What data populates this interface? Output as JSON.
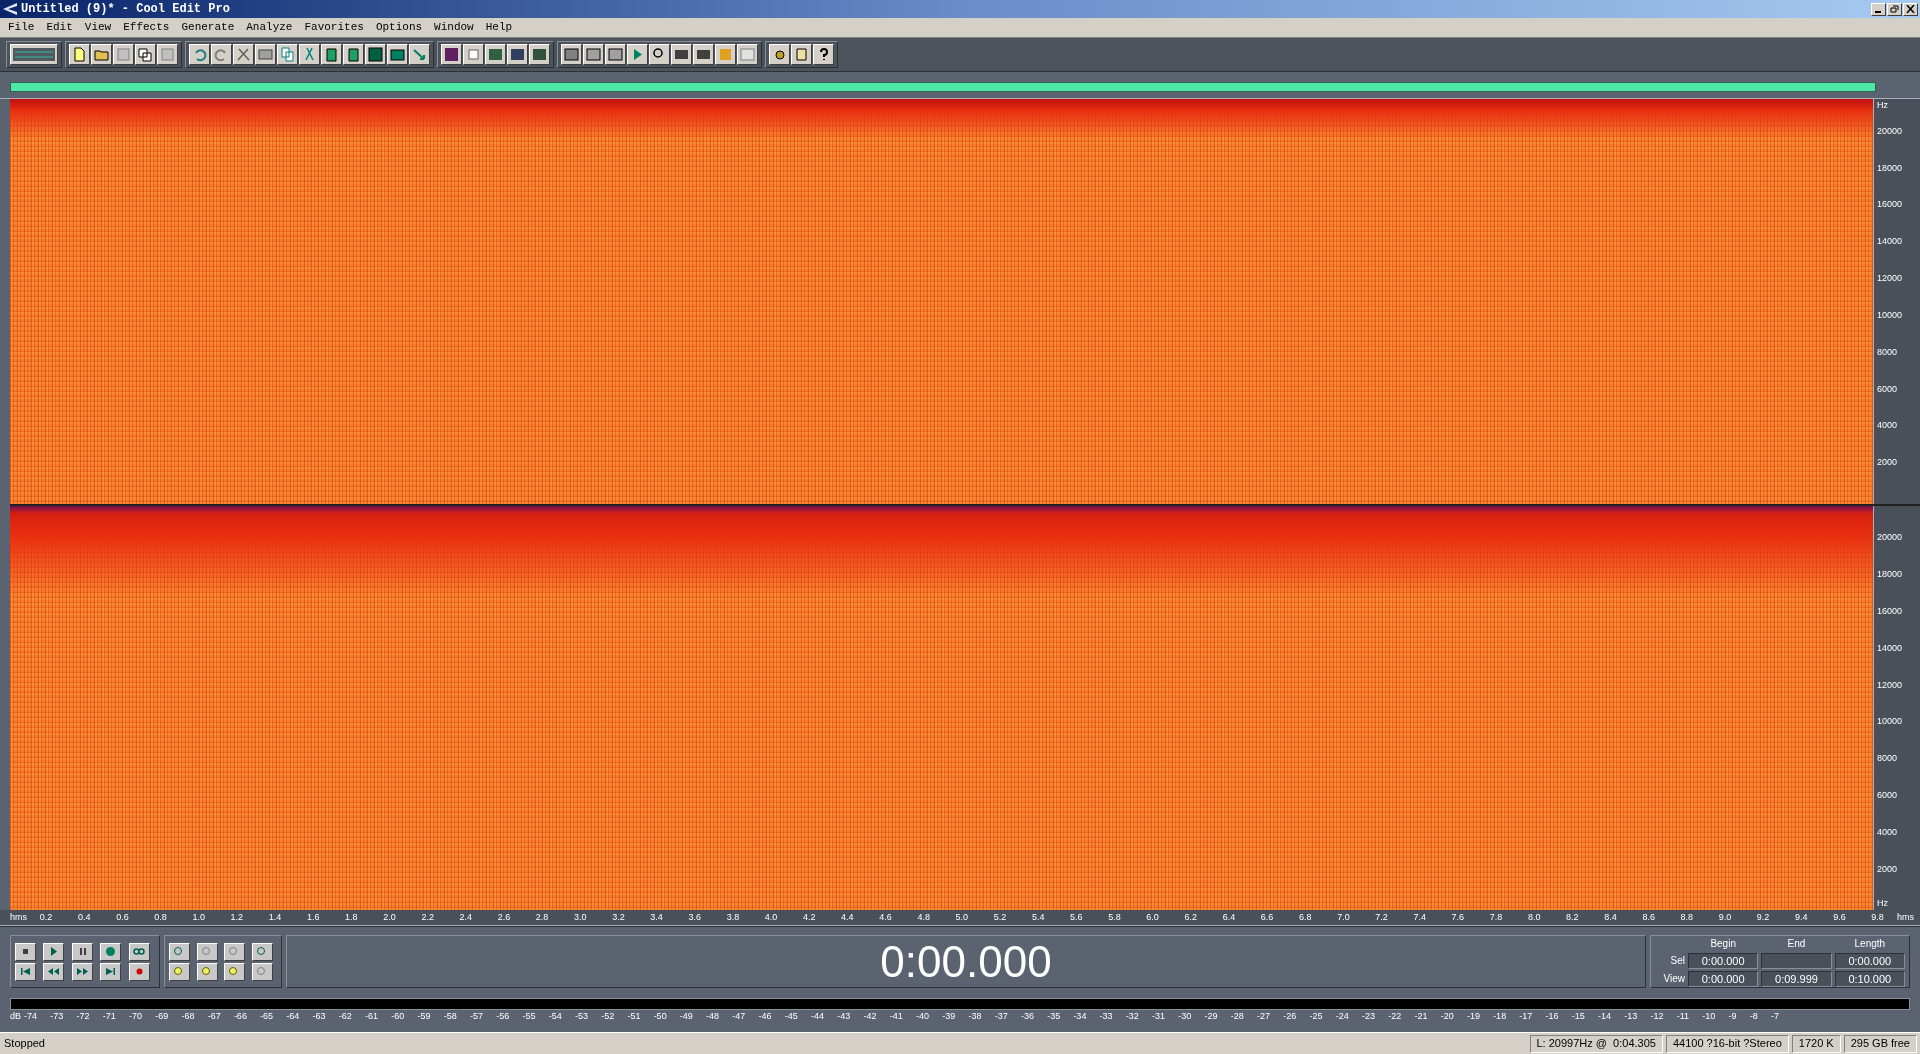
{
  "window": {
    "title": "Untitled (9)* - Cool Edit Pro"
  },
  "menu": [
    "File",
    "Edit",
    "View",
    "Effects",
    "Generate",
    "Analyze",
    "Favorites",
    "Options",
    "Window",
    "Help"
  ],
  "channels": [
    {
      "unit_top": "Hz",
      "ticks": [
        "20000",
        "18000",
        "16000",
        "14000",
        "12000",
        "10000",
        "8000",
        "6000",
        "4000",
        "2000"
      ]
    },
    {
      "ticks": [
        "20000",
        "18000",
        "16000",
        "14000",
        "12000",
        "10000",
        "8000",
        "6000",
        "4000",
        "2000"
      ],
      "unit_bottom": "Hz"
    }
  ],
  "time_ruler": {
    "unit_left": "hms",
    "ticks": [
      "0.2",
      "0.4",
      "0.6",
      "0.8",
      "1.0",
      "1.2",
      "1.4",
      "1.6",
      "1.8",
      "2.0",
      "2.2",
      "2.4",
      "2.6",
      "2.8",
      "3.0",
      "3.2",
      "3.4",
      "3.6",
      "3.8",
      "4.0",
      "4.2",
      "4.4",
      "4.6",
      "4.8",
      "5.0",
      "5.2",
      "5.4",
      "5.6",
      "5.8",
      "6.0",
      "6.2",
      "6.4",
      "6.6",
      "6.8",
      "7.0",
      "7.2",
      "7.4",
      "7.6",
      "7.8",
      "8.0",
      "8.2",
      "8.4",
      "8.6",
      "8.8",
      "9.0",
      "9.2",
      "9.4",
      "9.6",
      "9.8"
    ],
    "unit_right": "hms"
  },
  "time_display": "0:00.000",
  "selection": {
    "headers": [
      "Begin",
      "End",
      "Length"
    ],
    "rows": [
      {
        "label": "Sel",
        "begin": "0:00.000",
        "end": "",
        "length": "0:00.000"
      },
      {
        "label": "View",
        "begin": "0:00.000",
        "end": "0:09.999",
        "length": "0:10.000"
      }
    ]
  },
  "level_meter": {
    "unit": "dB",
    "ticks": [
      "-74",
      "-73",
      "-72",
      "-71",
      "-70",
      "-69",
      "-68",
      "-67",
      "-66",
      "-65",
      "-64",
      "-63",
      "-62",
      "-61",
      "-60",
      "-59",
      "-58",
      "-57",
      "-56",
      "-55",
      "-54",
      "-53",
      "-52",
      "-51",
      "-50",
      "-49",
      "-48",
      "-47",
      "-46",
      "-45",
      "-44",
      "-43",
      "-42",
      "-41",
      "-40",
      "-39",
      "-38",
      "-37",
      "-36",
      "-35",
      "-34",
      "-33",
      "-32",
      "-31",
      "-30",
      "-29",
      "-28",
      "-27",
      "-26",
      "-25",
      "-24",
      "-23",
      "-22",
      "-21",
      "-20",
      "-19",
      "-18",
      "-17",
      "-16",
      "-15",
      "-14",
      "-13",
      "-12",
      "-11",
      "-10",
      "-9",
      "-8",
      "-7"
    ]
  },
  "status_bar": {
    "state": "Stopped",
    "cells": [
      "L: 20997Hz @  0:04.305",
      "44100 ?16-bit ?Stereo",
      "1720 K",
      "295 GB free"
    ]
  }
}
